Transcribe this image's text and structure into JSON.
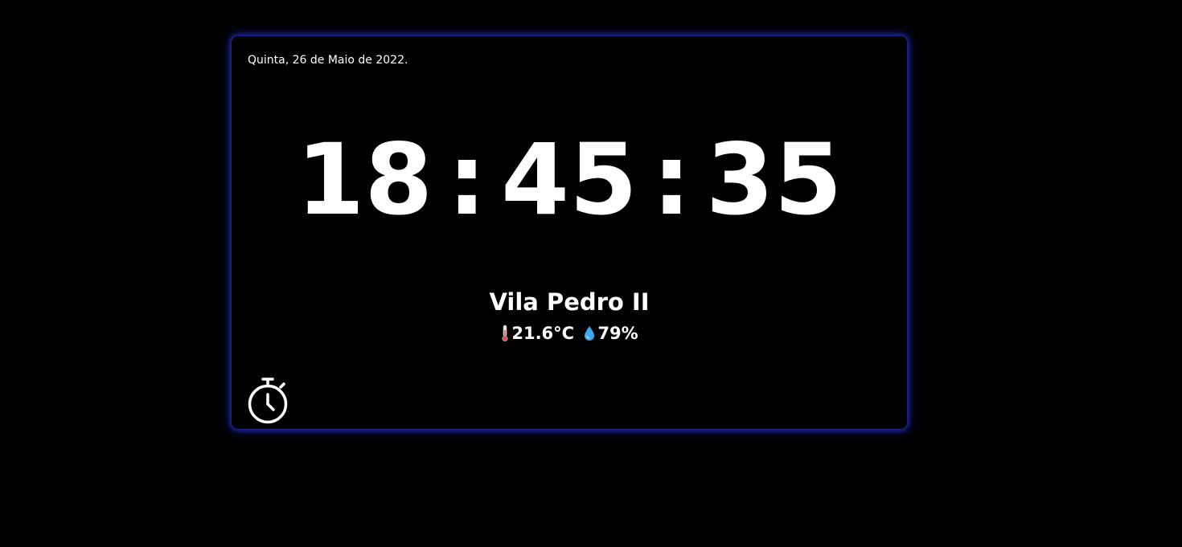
{
  "widget": {
    "date": "Quinta, 26 de Maio de 2022.",
    "clock": {
      "hours": "18",
      "minutes": "45",
      "seconds": "35",
      "separator": ":"
    },
    "location": "Vila Pedro II",
    "weather": {
      "temperature": "21.6°C",
      "humidity": "79%"
    },
    "timer_icon": "stopwatch-icon"
  },
  "colors": {
    "background": "#000000",
    "text": "#ffffff",
    "glow": "#2832c8",
    "droplet": "#3aa8f0",
    "thermometer_bulb": "#e05050"
  }
}
